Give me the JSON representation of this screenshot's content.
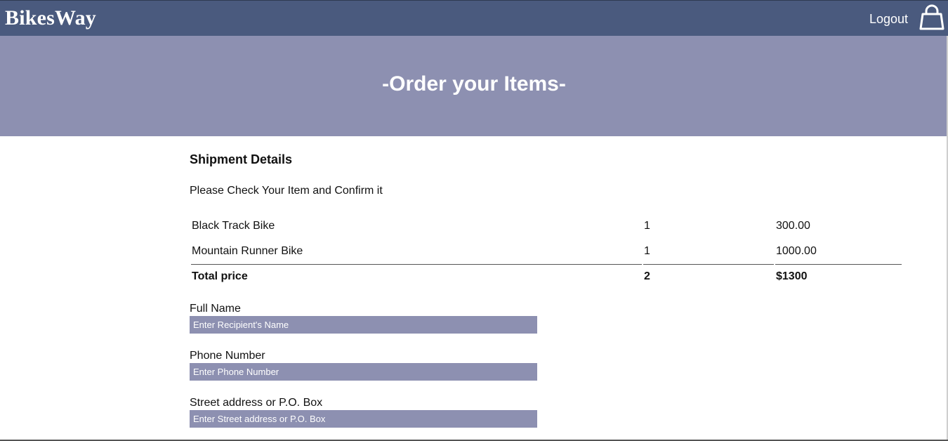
{
  "navbar": {
    "brand": "BikesWay",
    "logout_label": "Logout",
    "cart_icon": "shopping-bag-icon"
  },
  "hero": {
    "title": "-Order your Items-"
  },
  "shipment": {
    "title": "Shipment Details",
    "instructions": "Please Check Your Item and Confirm it",
    "items": [
      {
        "name": "Black Track Bike",
        "quantity": "1",
        "price": "300.00"
      },
      {
        "name": "Mountain Runner Bike",
        "quantity": "1",
        "price": "1000.00"
      }
    ],
    "total": {
      "label": "Total price",
      "quantity": "2",
      "price": "$1300"
    }
  },
  "form": {
    "full_name": {
      "label": "Full Name",
      "placeholder": "Enter Recipient's Name",
      "value": ""
    },
    "phone": {
      "label": "Phone Number",
      "placeholder": "Enter Phone Number",
      "value": ""
    },
    "street": {
      "label": "Street address or P.O. Box",
      "placeholder": "Enter Street address or P.O. Box",
      "value": ""
    }
  },
  "colors": {
    "navbar": "#4a5a7e",
    "hero": "#8d90b1",
    "input_fill": "#8d90b1"
  }
}
